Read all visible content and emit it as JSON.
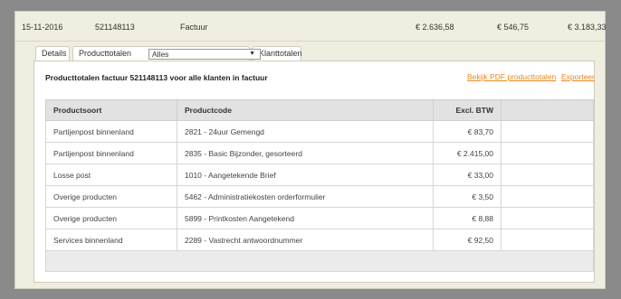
{
  "invoice": {
    "date": "15-11-2016",
    "number": "521148113",
    "type": "Factuur",
    "amount1": "€ 2.636,58",
    "amount2": "€ 546,75",
    "amount3": "€ 3.183,33"
  },
  "tabs": [
    {
      "label": "Details"
    },
    {
      "label": "Producttotalen"
    },
    {
      "label": "Klanttotalen"
    }
  ],
  "filter": {
    "selected": "Alles"
  },
  "panel": {
    "title": "Producttotalen factuur 521148113 voor alle klanten in factuur",
    "link_pdf": "Bekijk PDF producttotalen",
    "link_export": "Exporteer"
  },
  "table": {
    "headers": [
      "Productsoort",
      "Productcode",
      "Excl. BTW",
      ""
    ],
    "rows": [
      [
        "Partijenpost binnenland",
        "2821 - 24uur Gemengd",
        "€ 83,70"
      ],
      [
        "Partijenpost binnenland",
        "2835 - Basic Bijzonder, gesorteerd",
        "€ 2.415,00"
      ],
      [
        "Losse post",
        "1010 - Aangetekende Brief",
        "€ 33,00"
      ],
      [
        "Overige producten",
        "5462 - Administratiekosten orderformulier",
        "€ 3,50"
      ],
      [
        "Overige producten",
        "5899 - Printkosten Aangetekend",
        "€ 8,88"
      ],
      [
        "Services binnenland",
        "2289 - Vastrecht antwoordnummer",
        "€ 92,50"
      ]
    ]
  }
}
